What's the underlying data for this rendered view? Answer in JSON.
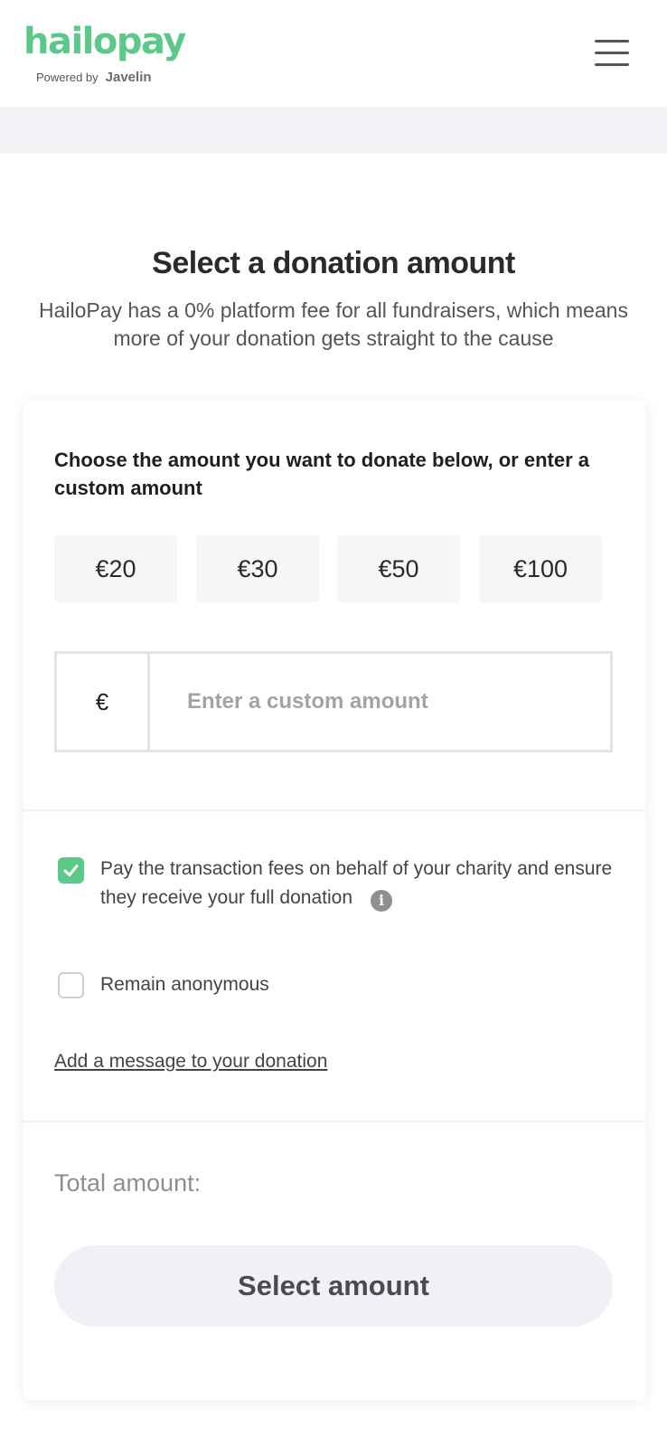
{
  "header": {
    "logo_text": "hailopay",
    "powered_by": "Powered by",
    "powered_brand": "Javelin",
    "menu_icon": "hamburger-menu-icon"
  },
  "intro": {
    "title": "Select a donation amount",
    "subtitle": "HailoPay has a 0% platform fee for all fundraisers, which means more of your donation gets straight to the cause"
  },
  "form": {
    "prompt": "Choose the amount you want to donate below, or enter a custom amount",
    "amounts": [
      "€20",
      "€30",
      "€50",
      "€100"
    ],
    "currency_symbol": "€",
    "custom_placeholder": "Enter a custom amount",
    "custom_value": "",
    "options": {
      "pay_fees": {
        "label": "Pay the transaction fees on behalf of your charity and ensure they receive your full donation",
        "checked": true,
        "info_icon": "info-icon"
      },
      "anonymous": {
        "label": "Remain anonymous",
        "checked": false
      }
    },
    "message_link": "Add a message to your donation",
    "total_label": "Total amount:",
    "submit_label": "Select amount"
  },
  "colors": {
    "brand_green": "#5cc98a",
    "button_bg": "#f1f1f5",
    "page_band": "#f4f4f8"
  }
}
